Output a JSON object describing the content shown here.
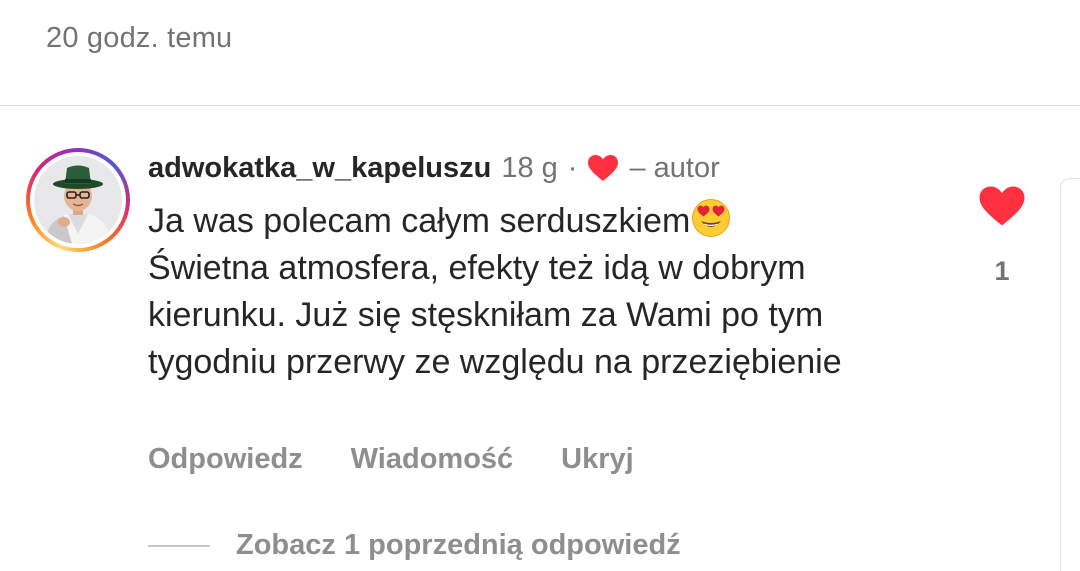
{
  "post": {
    "timestamp": "20 godz. temu"
  },
  "comment": {
    "username": "adwokatka_w_kapeluszu",
    "time": "18 g",
    "separator": "·",
    "author_label": "– autor",
    "text": "Ja was polecam całym serduszkiem",
    "text_emoji": "heart-eyes-emoji",
    "text_rest": "Świetna atmosfera, efekty też idą w dobrym kierunku. Już się stęskniłam za Wami po tym tygodniu przerwy ze względu na przeziębienie",
    "like_count": "1",
    "actions": {
      "reply": "Odpowiedz",
      "message": "Wiadomość",
      "hide": "Ukryj"
    },
    "view_replies": "Zobacz 1 poprzednią odpowiedź"
  },
  "colors": {
    "heart": "#ff3040",
    "meta_text": "#737373",
    "action_text": "#8e8e8e",
    "primary_text": "#262626",
    "divider": "#dbdbdb"
  },
  "icons": {
    "author_liked": "heart-icon",
    "like_button": "heart-icon",
    "avatar": "avatar-photo"
  }
}
